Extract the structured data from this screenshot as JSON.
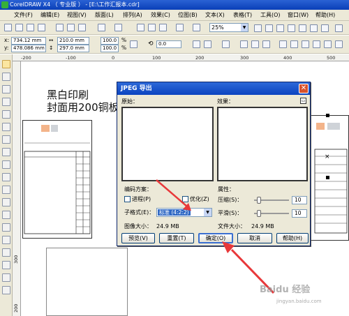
{
  "window": {
    "title": "CorelDRAW X4 （ 专业版 ） - [E:\\工作汇报本.cdr]"
  },
  "menu": [
    "文件(F)",
    "编辑(E)",
    "视图(V)",
    "版面(L)",
    "排列(A)",
    "效果(C)",
    "位图(B)",
    "文本(X)",
    "表格(T)",
    "工具(O)",
    "窗口(W)",
    "帮助(H)"
  ],
  "toolbar": {
    "zoom": "25%"
  },
  "props": {
    "x_label": "x:",
    "x_value": "734.12 mm",
    "y_label": "y:",
    "y_value": "478.086 mm",
    "w_value": "210.0 mm",
    "h_value": "297.0 mm",
    "sx_value": "100.0",
    "sy_value": "100.0",
    "pct1": "%",
    "pct2": "%",
    "rotation": "0.0"
  },
  "rulers": {
    "top": [
      "-200",
      "-100",
      "0",
      "100",
      "200",
      "300",
      "400",
      "500"
    ],
    "left": [
      "300",
      "200"
    ]
  },
  "canvas": {
    "line1": "黑白印刷",
    "line2": "封面用200铜板"
  },
  "dialog": {
    "title": "JPEG 导出",
    "original_label": "原始：",
    "effect_label": "效果：",
    "encoding_label": "编码方案：",
    "progressive_label": "进程(P)",
    "optimize_label": "优化(Z)",
    "subformat_label": "子格式(E)：",
    "subformat_value": "标准 (4:2:2)",
    "image_size_label": "图像大小：",
    "image_size_value": "24.9 MB",
    "attributes_label": "属性：",
    "compression_label": "压缩(S)：",
    "compression_value": "10",
    "smoothing_label": "平滑(S)：",
    "smoothing_value": "10",
    "file_size_label": "文件大小：",
    "file_size_value": "24.9 MB",
    "buttons": {
      "preview": "预览(V)",
      "reset": "重置(T)",
      "ok": "确定(O)",
      "cancel": "取消",
      "help": "帮助(H)"
    }
  },
  "watermark": {
    "text": "Baidu 经验",
    "url": "jingyan.baidu.com"
  },
  "colors": {
    "title_blue": "#0b44c0",
    "dialog_bg": "#ece9d8",
    "selection_blue": "#316ac5",
    "arrow_red": "#e8383a"
  }
}
